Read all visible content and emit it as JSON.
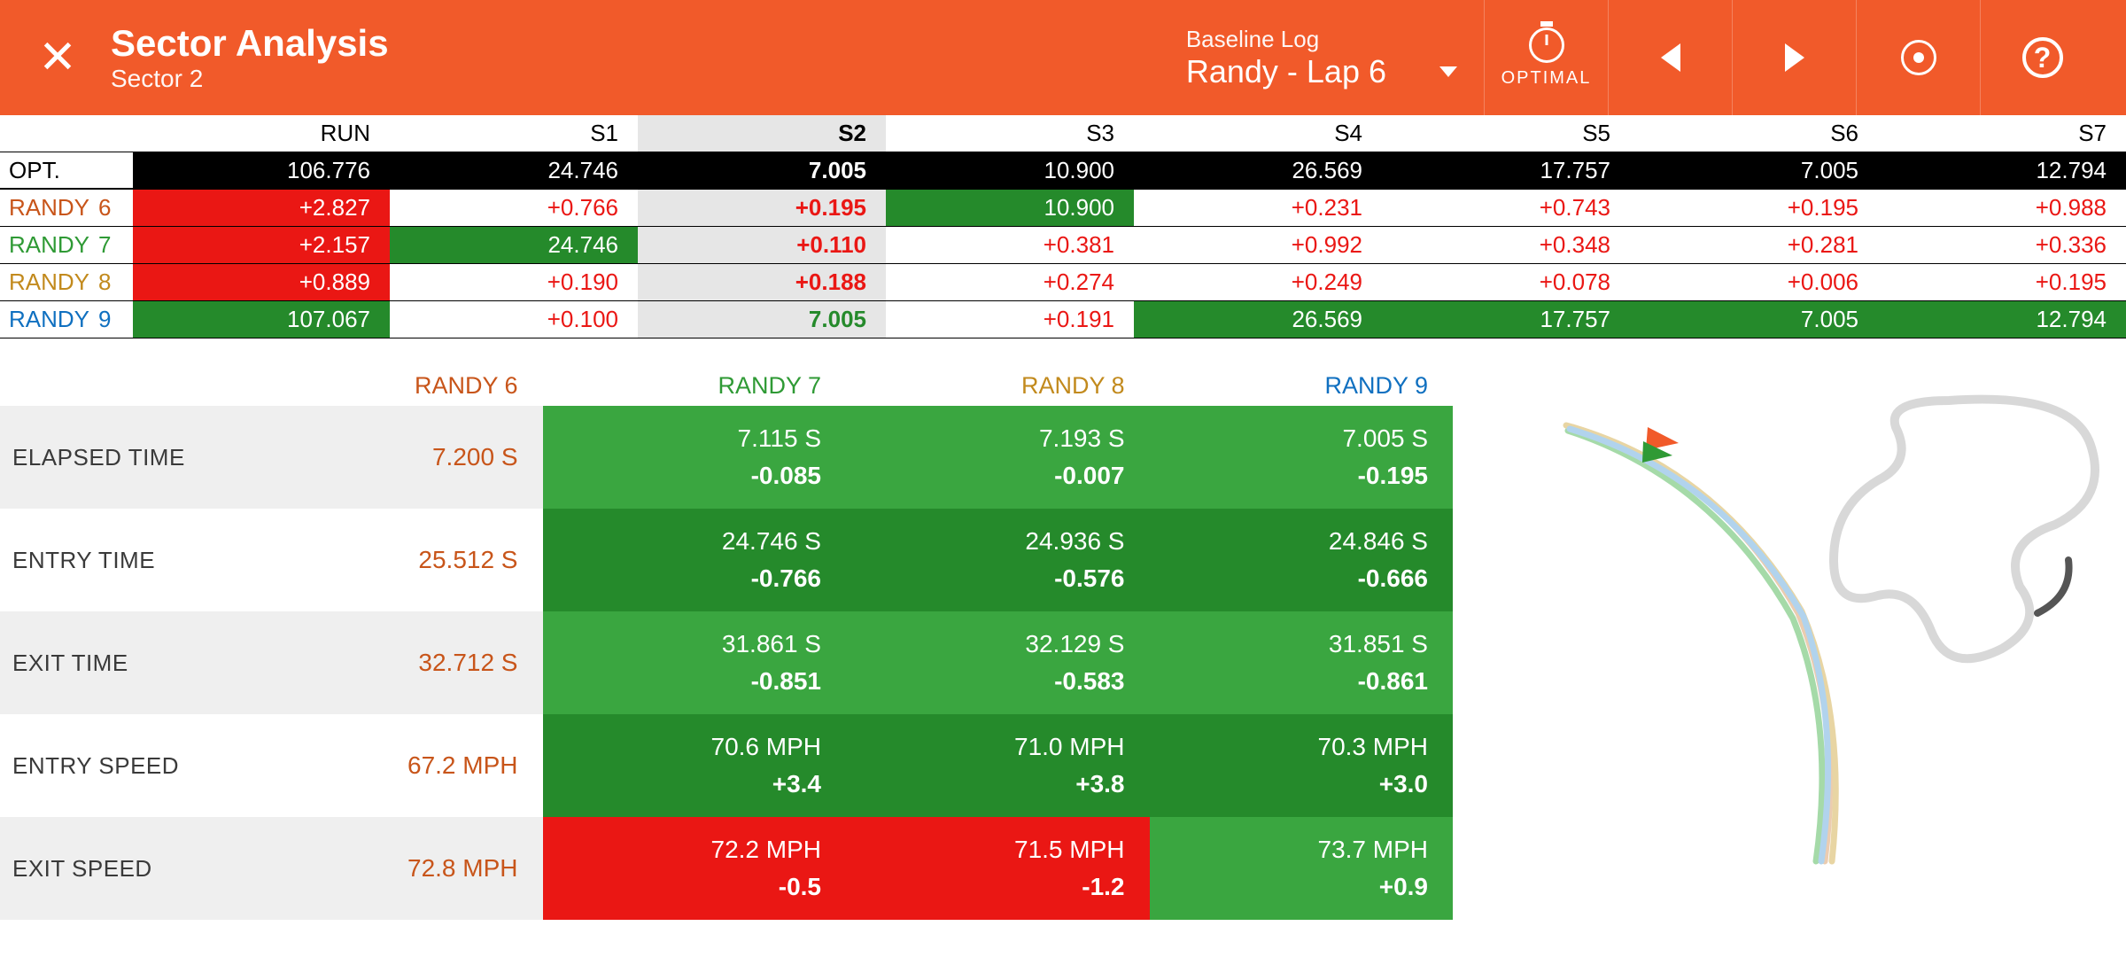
{
  "header": {
    "title": "Sector Analysis",
    "subtitle": "Sector 2",
    "baseline_label": "Baseline Log",
    "baseline_value": "Randy - Lap 6",
    "optimal_label": "OPTIMAL"
  },
  "sector_table": {
    "columns": [
      "",
      "RUN",
      "S1",
      "S2",
      "S3",
      "S4",
      "S5",
      "S6",
      "S7"
    ],
    "highlight_col": 3,
    "rows": [
      {
        "driver": "OPT.",
        "lap": "",
        "color": "#000",
        "kind": "opt",
        "cells": [
          {
            "v": "106.776"
          },
          {
            "v": "24.746"
          },
          {
            "v": "7.005",
            "bold": true
          },
          {
            "v": "10.900"
          },
          {
            "v": "26.569"
          },
          {
            "v": "17.757"
          },
          {
            "v": "7.005"
          },
          {
            "v": "12.794"
          }
        ]
      },
      {
        "driver": "RANDY",
        "lap": "6",
        "color": "#c8551a",
        "kind": "lap",
        "cells": [
          {
            "v": "+2.827",
            "bg": "red",
            "fg": "white"
          },
          {
            "v": "+0.766",
            "fg": "red"
          },
          {
            "v": "+0.195",
            "bg": "grey",
            "fg": "red",
            "bold": true
          },
          {
            "v": "10.900",
            "bg": "green",
            "fg": "white"
          },
          {
            "v": "+0.231",
            "fg": "red"
          },
          {
            "v": "+0.743",
            "fg": "red"
          },
          {
            "v": "+0.195",
            "fg": "red"
          },
          {
            "v": "+0.988",
            "fg": "red"
          }
        ]
      },
      {
        "driver": "RANDY",
        "lap": "7",
        "color": "#2f9a35",
        "kind": "lap",
        "cells": [
          {
            "v": "+2.157",
            "bg": "red",
            "fg": "white"
          },
          {
            "v": "24.746",
            "bg": "green",
            "fg": "white"
          },
          {
            "v": "+0.110",
            "bg": "grey",
            "fg": "red",
            "bold": true
          },
          {
            "v": "+0.381",
            "fg": "red"
          },
          {
            "v": "+0.992",
            "fg": "red"
          },
          {
            "v": "+0.348",
            "fg": "red"
          },
          {
            "v": "+0.281",
            "fg": "red"
          },
          {
            "v": "+0.336",
            "fg": "red"
          }
        ]
      },
      {
        "driver": "RANDY",
        "lap": "8",
        "color": "#c28a1d",
        "kind": "lap",
        "cells": [
          {
            "v": "+0.889",
            "bg": "red",
            "fg": "white"
          },
          {
            "v": "+0.190",
            "fg": "red"
          },
          {
            "v": "+0.188",
            "bg": "grey",
            "fg": "red",
            "bold": true
          },
          {
            "v": "+0.274",
            "fg": "red"
          },
          {
            "v": "+0.249",
            "fg": "red"
          },
          {
            "v": "+0.078",
            "fg": "red"
          },
          {
            "v": "+0.006",
            "fg": "red"
          },
          {
            "v": "+0.195",
            "fg": "red"
          }
        ]
      },
      {
        "driver": "RANDY",
        "lap": "9",
        "color": "#1070c0",
        "kind": "lap",
        "cells": [
          {
            "v": "107.067",
            "bg": "green",
            "fg": "white"
          },
          {
            "v": "+0.100",
            "fg": "red"
          },
          {
            "v": "7.005",
            "bg": "grey",
            "fg": "green",
            "bold": true
          },
          {
            "v": "+0.191",
            "fg": "red"
          },
          {
            "v": "26.569",
            "bg": "green",
            "fg": "white"
          },
          {
            "v": "17.757",
            "bg": "green",
            "fg": "white"
          },
          {
            "v": "7.005",
            "bg": "green",
            "fg": "white"
          },
          {
            "v": "12.794",
            "bg": "green",
            "fg": "white"
          }
        ]
      }
    ]
  },
  "metrics": {
    "laps": [
      {
        "name": "RANDY 6",
        "color": "#c8551a"
      },
      {
        "name": "RANDY 7",
        "color": "#2f9a35"
      },
      {
        "name": "RANDY 8",
        "color": "#c28a1d"
      },
      {
        "name": "RANDY 9",
        "color": "#1070c0"
      }
    ],
    "rows": [
      {
        "label": "ELAPSED TIME",
        "values": [
          {
            "main": "7.200 S",
            "delta": "",
            "kind": "base"
          },
          {
            "main": "7.115 S",
            "delta": "-0.085",
            "kind": "green"
          },
          {
            "main": "7.193 S",
            "delta": "-0.007",
            "kind": "green"
          },
          {
            "main": "7.005 S",
            "delta": "-0.195",
            "kind": "green"
          }
        ]
      },
      {
        "label": "ENTRY TIME",
        "values": [
          {
            "main": "25.512 S",
            "delta": "",
            "kind": "base"
          },
          {
            "main": "24.746 S",
            "delta": "-0.766",
            "kind": "green"
          },
          {
            "main": "24.936 S",
            "delta": "-0.576",
            "kind": "green"
          },
          {
            "main": "24.846 S",
            "delta": "-0.666",
            "kind": "green"
          }
        ]
      },
      {
        "label": "EXIT TIME",
        "values": [
          {
            "main": "32.712 S",
            "delta": "",
            "kind": "base"
          },
          {
            "main": "31.861 S",
            "delta": "-0.851",
            "kind": "green"
          },
          {
            "main": "32.129 S",
            "delta": "-0.583",
            "kind": "green"
          },
          {
            "main": "31.851 S",
            "delta": "-0.861",
            "kind": "green"
          }
        ]
      },
      {
        "label": "ENTRY SPEED",
        "values": [
          {
            "main": "67.2 MPH",
            "delta": "",
            "kind": "base"
          },
          {
            "main": "70.6 MPH",
            "delta": "+3.4",
            "kind": "green"
          },
          {
            "main": "71.0 MPH",
            "delta": "+3.8",
            "kind": "green"
          },
          {
            "main": "70.3 MPH",
            "delta": "+3.0",
            "kind": "green"
          }
        ]
      },
      {
        "label": "EXIT SPEED",
        "values": [
          {
            "main": "72.8 MPH",
            "delta": "",
            "kind": "base"
          },
          {
            "main": "72.2 MPH",
            "delta": "-0.5",
            "kind": "red"
          },
          {
            "main": "71.5 MPH",
            "delta": "-1.2",
            "kind": "red"
          },
          {
            "main": "73.7 MPH",
            "delta": "+0.9",
            "kind": "green"
          }
        ]
      }
    ]
  }
}
